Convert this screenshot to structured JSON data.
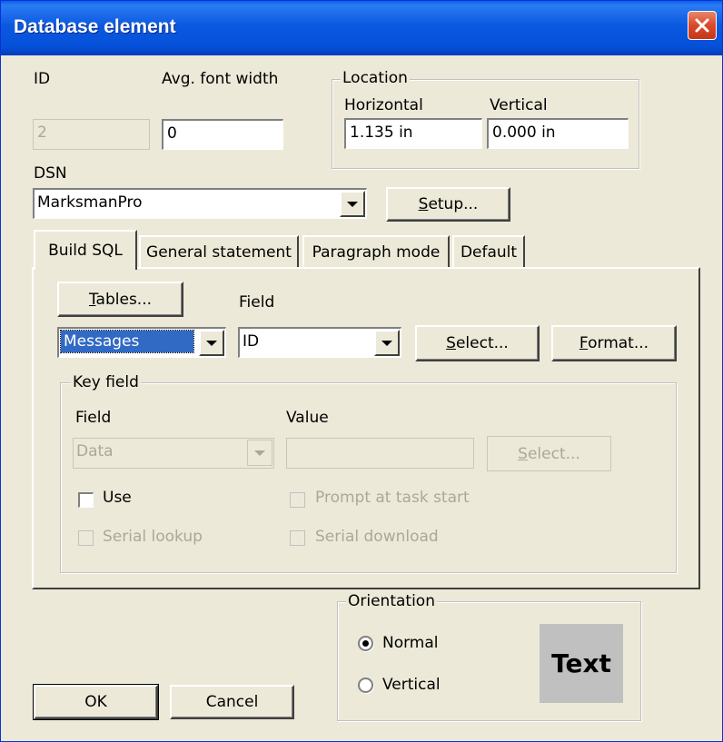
{
  "window": {
    "title": "Database element",
    "close_icon": "close-icon"
  },
  "top": {
    "id_label": "ID",
    "id_value": "2",
    "font_width_label": "Avg. font width",
    "font_width_value": "0",
    "location_group": "Location",
    "horizontal_label": "Horizontal",
    "horizontal_value": "1.135 in",
    "vertical_label": "Vertical",
    "vertical_value": "0.000 in"
  },
  "dsn": {
    "label": "DSN",
    "value": "MarksmanPro",
    "setup_button": "Setup..."
  },
  "tabs": [
    {
      "label": "Build SQL",
      "active": true
    },
    {
      "label": "General statement",
      "active": false
    },
    {
      "label": "Paragraph mode",
      "active": false
    },
    {
      "label": "Default",
      "active": false
    }
  ],
  "build_sql": {
    "tables_button": "Tables...",
    "field_label": "Field",
    "table_value": "Messages",
    "field_value": "ID",
    "select_button": "Select...",
    "format_button": "Format..."
  },
  "key_field": {
    "group": "Key field",
    "field_label": "Field",
    "value_label": "Value",
    "field_value": "Data",
    "value_value": "",
    "select_button": "Select...",
    "use_label": "Use",
    "prompt_label": "Prompt at task start",
    "serial_lookup_label": "Serial lookup",
    "serial_download_label": "Serial download"
  },
  "orientation": {
    "group": "Orientation",
    "normal_label": "Normal",
    "vertical_label": "Vertical",
    "selected": "Normal",
    "preview_text": "Text"
  },
  "footer": {
    "ok_button": "OK",
    "cancel_button": "Cancel"
  },
  "colors": {
    "titlebar": "#0a5fe8",
    "dialog_bg": "#ece9d8",
    "selection": "#316ac5"
  }
}
